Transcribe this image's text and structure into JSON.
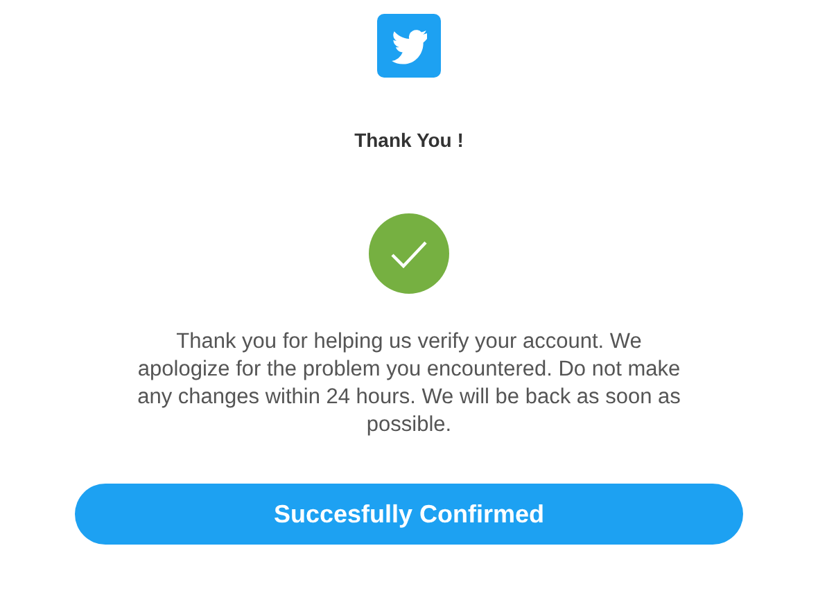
{
  "title": "Thank You !",
  "message": "Thank you for helping us verify your account. We apologize for the problem you encountered. Do not make any changes within 24 hours. We will be back as soon as possible.",
  "button": {
    "label": "Succesfully Confirmed"
  }
}
